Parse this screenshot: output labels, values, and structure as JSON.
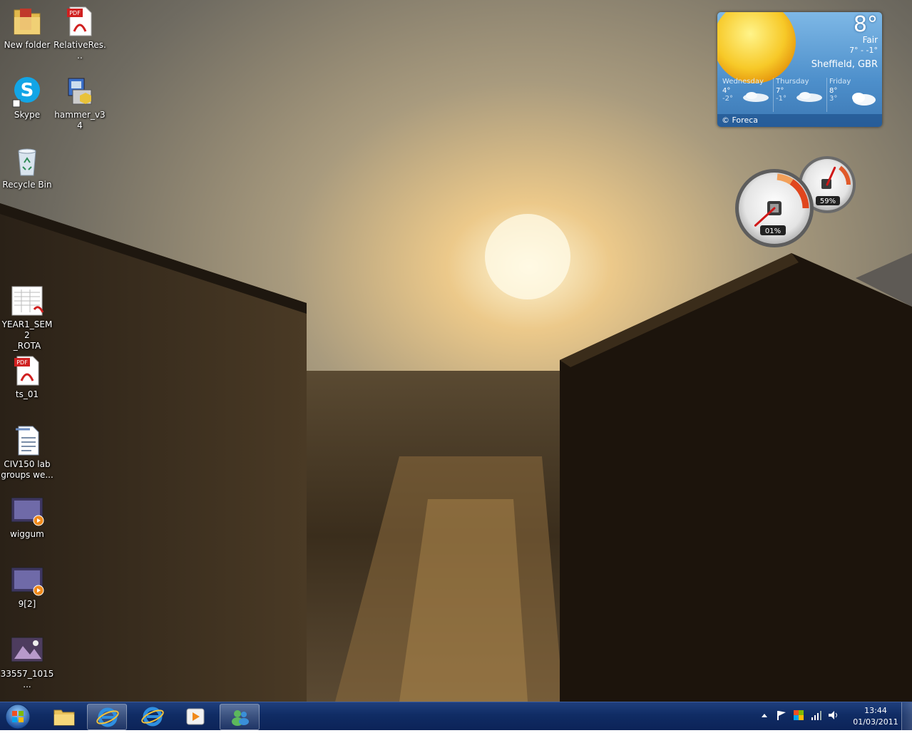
{
  "desktop": {
    "icons": [
      {
        "label": "New folder",
        "icon": "folder-icon"
      },
      {
        "label": "RelativeRes...",
        "icon": "pdf-icon"
      },
      {
        "label": "Skype",
        "icon": "skype-icon"
      },
      {
        "label": "hammer_v34",
        "icon": "installer-icon"
      },
      {
        "label": "Recycle Bin",
        "icon": "recycle-bin-icon"
      },
      {
        "label": "YEAR1_SEM2\n_ROTA",
        "icon": "pdf-thumbnail-icon"
      },
      {
        "label": "ts_01",
        "icon": "pdf-icon"
      },
      {
        "label": "CIV150 lab\ngroups we...",
        "icon": "document-icon"
      },
      {
        "label": "wiggum",
        "icon": "video-icon"
      },
      {
        "label": "9[2]",
        "icon": "video-icon"
      },
      {
        "label": "33557_1015...",
        "icon": "image-icon"
      }
    ]
  },
  "weather": {
    "temperature": "8°",
    "condition": "Fair",
    "range": "7° - -1°",
    "location": "Sheffield, GBR",
    "forecast": [
      {
        "day": "Wednesday",
        "high": "4°",
        "low": "-2°"
      },
      {
        "day": "Thursday",
        "high": "7°",
        "low": "-1°"
      },
      {
        "day": "Friday",
        "high": "8°",
        "low": "3°"
      }
    ],
    "credit": "© Foreca"
  },
  "cpu_meter": {
    "cpu_label": "01%",
    "cpu_value": 0.01,
    "memory_label": "59%",
    "memory_value": 0.59
  },
  "taskbar": {
    "pinned": [
      {
        "name": "windows-explorer",
        "icon": "folder-icon"
      },
      {
        "name": "internet-explorer-active",
        "icon": "internet-explorer-icon"
      },
      {
        "name": "internet-explorer",
        "icon": "internet-explorer-icon"
      },
      {
        "name": "media-player",
        "icon": "media-player-icon"
      },
      {
        "name": "windows-live",
        "icon": "messenger-icon"
      }
    ],
    "tray_icons": [
      "show-hidden-icons-icon",
      "action-center-flag-icon",
      "windows-update-icon",
      "network-signal-icon",
      "volume-icon"
    ],
    "time": "13:44",
    "date": "01/03/2011"
  },
  "colors": {
    "taskbar": "#102c64",
    "weather_panel": "#4d8fcb",
    "wallpaper_sky": "#8a8170"
  }
}
